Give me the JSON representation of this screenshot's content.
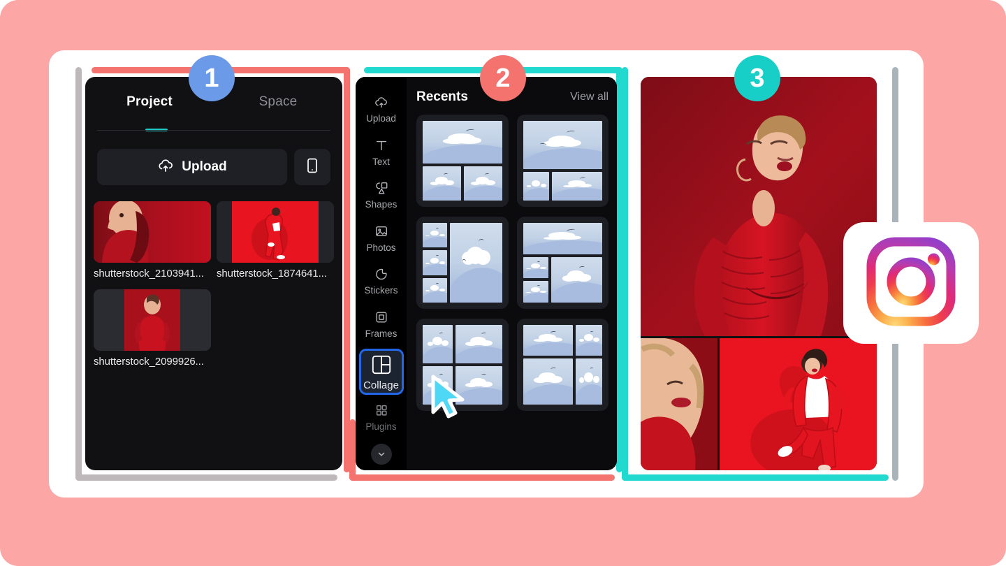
{
  "stage": {
    "background_color": "#FCA6A6",
    "card_background": "#FFFFFF"
  },
  "annotations": {
    "colors": {
      "gray": "#BFB8BA",
      "coral": "#F4736F",
      "teal": "#22D9CF"
    },
    "badges": [
      {
        "label": "1",
        "color": "#6B9BE8"
      },
      {
        "label": "2",
        "color": "#F4736F"
      },
      {
        "label": "3",
        "color": "#17CFC6"
      }
    ]
  },
  "panel1": {
    "tabs": [
      {
        "label": "Project",
        "active": true
      },
      {
        "label": "Space",
        "active": false
      }
    ],
    "upload_button": {
      "label": "Upload",
      "icon": "cloud-upload-icon"
    },
    "mobile_button": {
      "icon": "mobile-phone-icon"
    },
    "files": [
      {
        "name": "shutterstock_2103941..."
      },
      {
        "name": "shutterstock_1874641..."
      },
      {
        "name": "shutterstock_2099926..."
      }
    ]
  },
  "panel2": {
    "rail": [
      {
        "label": "Upload",
        "icon": "cloud-upload-icon",
        "selected": false
      },
      {
        "label": "Text",
        "icon": "text-t-icon",
        "selected": false
      },
      {
        "label": "Shapes",
        "icon": "shapes-icon",
        "selected": false
      },
      {
        "label": "Photos",
        "icon": "photo-icon",
        "selected": false
      },
      {
        "label": "Stickers",
        "icon": "sticker-icon",
        "selected": false
      },
      {
        "label": "Frames",
        "icon": "frame-icon",
        "selected": false
      },
      {
        "label": "Collage",
        "icon": "collage-icon",
        "selected": true
      },
      {
        "label": "Plugins",
        "icon": "plugins-grid-icon",
        "selected": false
      }
    ],
    "rail_more": {
      "icon": "chevron-down-icon"
    },
    "selected_highlight_color": "#2267E8",
    "header": {
      "title": "Recents",
      "view_all": "View all"
    },
    "templates": [
      {
        "layout": "lay-a",
        "cells": 3
      },
      {
        "layout": "lay-b",
        "cells": 3
      },
      {
        "layout": "lay-c",
        "cells": 4
      },
      {
        "layout": "lay-d",
        "cells": 4
      },
      {
        "layout": "lay-e",
        "cells": 4
      },
      {
        "layout": "lay-f",
        "cells": 4
      }
    ],
    "cursor": {
      "icon": "mouse-pointer-icon",
      "color": "#4FD8F5"
    }
  },
  "panel3": {
    "collage": {
      "top_image": "woman-in-red-ruched-dress",
      "bottom_left_image": "woman-red-lips-closeup",
      "bottom_right_image": "woman-in-red-suit-jumping"
    }
  },
  "instagram": {
    "icon": "instagram-logo-icon"
  }
}
